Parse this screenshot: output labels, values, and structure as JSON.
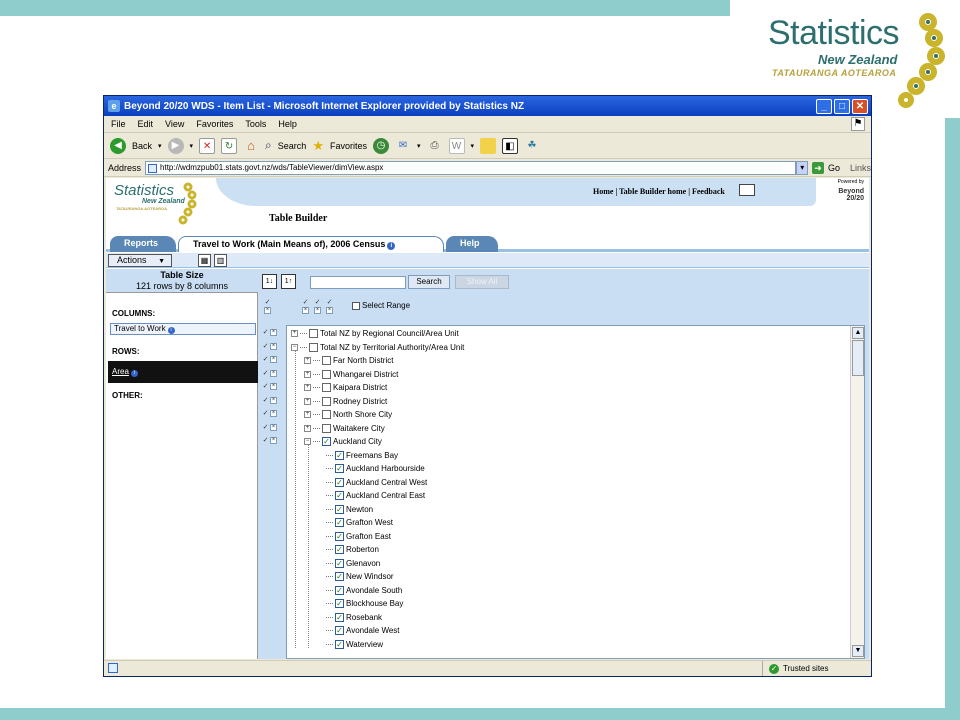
{
  "slide": {
    "logo": {
      "statistics": "Statistics",
      "new_zealand": "New Zealand",
      "tauranga": "TATAURANGA AOTEAROA"
    }
  },
  "browser": {
    "title": "Beyond 20/20 WDS - Item List - Microsoft Internet Explorer provided by Statistics NZ",
    "menu": [
      "File",
      "Edit",
      "View",
      "Favorites",
      "Tools",
      "Help"
    ],
    "toolbar": {
      "back": "Back",
      "search": "Search",
      "favorites": "Favorites"
    },
    "address": {
      "label": "Address",
      "url": "http://wdmzpub01.stats.govt.nz/wds/TableViewer/dimView.aspx",
      "go": "Go",
      "links": "Links"
    },
    "status": {
      "zone": "Trusted sites"
    }
  },
  "site": {
    "logo": {
      "statistics": "Statistics",
      "new_zealand": "New Zealand",
      "tauranga": "TATAURANGA AOTEAROA"
    },
    "header_links": {
      "home": "Home",
      "sep1": " | ",
      "table_builder_home": "Table Builder home",
      "sep2": " | ",
      "feedback": "Feedback"
    },
    "powered_by": "Powered by",
    "beyond": "Beyond 20/20",
    "page_title": "Table Builder"
  },
  "tabs": [
    {
      "label": "Reports",
      "active": false
    },
    {
      "label": "Travel to Work (Main Means of), 2006 Census",
      "active": true
    },
    {
      "label": "Help",
      "active": false
    }
  ],
  "actions": {
    "label": "Actions"
  },
  "left_panel": {
    "table_size_title": "Table Size",
    "table_size_value": "121 rows by 8 columns",
    "columns_label": "COLUMNS:",
    "columns_item": "Travel to Work",
    "rows_label": "ROWS:",
    "rows_item": "Area",
    "other_label": "OTHER:"
  },
  "right_panel": {
    "search_button": "Search",
    "show_all_button": "Show All",
    "select_range_label": "Select Range"
  },
  "tree": [
    {
      "label": "Total NZ by Regional Council/Area Unit",
      "level": 0,
      "expander": "+",
      "checked": false
    },
    {
      "label": "Total NZ by Territorial Authority/Area Unit",
      "level": 0,
      "expander": "-",
      "checked": false
    },
    {
      "label": "Far North District",
      "level": 1,
      "expander": "+",
      "checked": false
    },
    {
      "label": "Whangarei District",
      "level": 1,
      "expander": "+",
      "checked": false
    },
    {
      "label": "Kaipara District",
      "level": 1,
      "expander": "+",
      "checked": false
    },
    {
      "label": "Rodney District",
      "level": 1,
      "expander": "+",
      "checked": false
    },
    {
      "label": "North Shore City",
      "level": 1,
      "expander": "+",
      "checked": false
    },
    {
      "label": "Waitakere City",
      "level": 1,
      "expander": "+",
      "checked": false
    },
    {
      "label": "Auckland City",
      "level": 1,
      "expander": "-",
      "checked": true
    },
    {
      "label": "Freemans Bay",
      "level": 2,
      "expander": "",
      "checked": true
    },
    {
      "label": "Auckland Harbourside",
      "level": 2,
      "expander": "",
      "checked": true
    },
    {
      "label": "Auckland Central West",
      "level": 2,
      "expander": "",
      "checked": true
    },
    {
      "label": "Auckland Central East",
      "level": 2,
      "expander": "",
      "checked": true
    },
    {
      "label": "Newton",
      "level": 2,
      "expander": "",
      "checked": true
    },
    {
      "label": "Grafton West",
      "level": 2,
      "expander": "",
      "checked": true
    },
    {
      "label": "Grafton East",
      "level": 2,
      "expander": "",
      "checked": true
    },
    {
      "label": "Roberton",
      "level": 2,
      "expander": "",
      "checked": true
    },
    {
      "label": "Glenavon",
      "level": 2,
      "expander": "",
      "checked": true
    },
    {
      "label": "New Windsor",
      "level": 2,
      "expander": "",
      "checked": true
    },
    {
      "label": "Avondale South",
      "level": 2,
      "expander": "",
      "checked": true
    },
    {
      "label": "Blockhouse Bay",
      "level": 2,
      "expander": "",
      "checked": true
    },
    {
      "label": "Rosebank",
      "level": 2,
      "expander": "",
      "checked": true
    },
    {
      "label": "Avondale West",
      "level": 2,
      "expander": "",
      "checked": true
    },
    {
      "label": "Waterview",
      "level": 2,
      "expander": "",
      "checked": true
    }
  ],
  "colors": {
    "slide_border": "#8fcccc",
    "title_bar": "#0a3fbf",
    "panel_blue": "#c9def2",
    "tab_blue": "#5a87b5"
  }
}
